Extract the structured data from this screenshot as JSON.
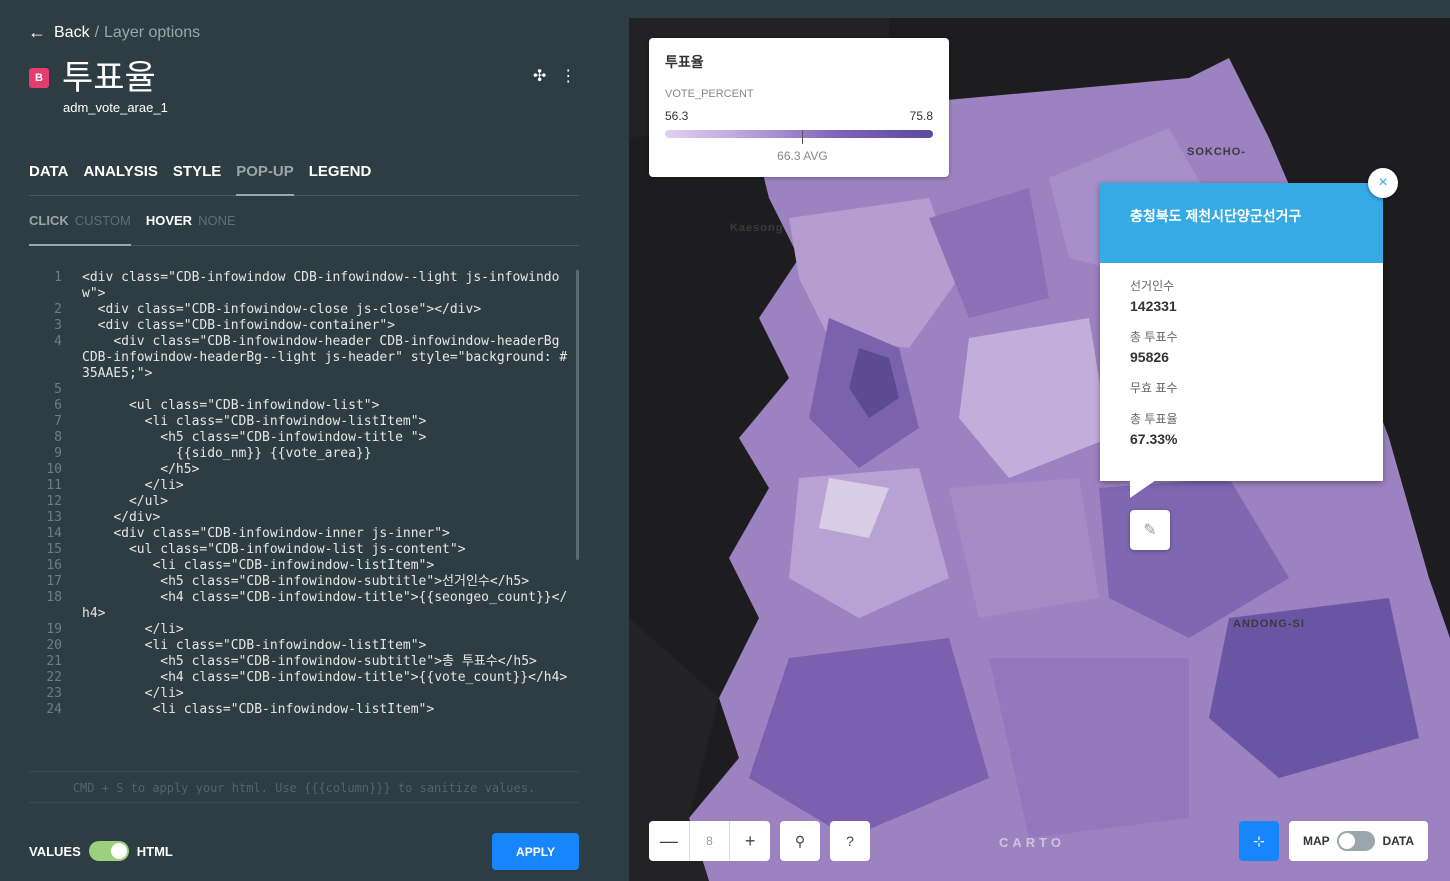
{
  "header": {
    "back_label": "Back",
    "separator": "/",
    "section": "Layer options",
    "layer_letter": "B",
    "layer_title": "투표율",
    "layer_source": "adm_vote_arae_1"
  },
  "tabs": [
    "DATA",
    "ANALYSIS",
    "STYLE",
    "POP-UP",
    "LEGEND"
  ],
  "subtabs": {
    "click": "CLICK",
    "custom": "CUSTOM",
    "hover": "HOVER",
    "none": "NONE"
  },
  "editor": {
    "lines": [
      {
        "n": "1",
        "code": "<div class=\"CDB-infowindow CDB-infowindow--light js-infowindow\">"
      },
      {
        "n": "2",
        "code": "  <div class=\"CDB-infowindow-close js-close\"></div>"
      },
      {
        "n": "3",
        "code": "  <div class=\"CDB-infowindow-container\">"
      },
      {
        "n": "4",
        "code": "    <div class=\"CDB-infowindow-header CDB-infowindow-headerBg CDB-infowindow-headerBg--light js-header\" style=\"background: #35AAE5;\">"
      },
      {
        "n": "5",
        "code": ""
      },
      {
        "n": "6",
        "code": "      <ul class=\"CDB-infowindow-list\">"
      },
      {
        "n": "7",
        "code": "        <li class=\"CDB-infowindow-listItem\">"
      },
      {
        "n": "8",
        "code": "          <h5 class=\"CDB-infowindow-title \">"
      },
      {
        "n": "9",
        "code": "            {{sido_nm}} {{vote_area}}"
      },
      {
        "n": "10",
        "code": "          </h5>"
      },
      {
        "n": "11",
        "code": "        </li>"
      },
      {
        "n": "12",
        "code": "      </ul>"
      },
      {
        "n": "13",
        "code": "    </div>"
      },
      {
        "n": "14",
        "code": "    <div class=\"CDB-infowindow-inner js-inner\">"
      },
      {
        "n": "15",
        "code": "      <ul class=\"CDB-infowindow-list js-content\">"
      },
      {
        "n": "16",
        "code": "         <li class=\"CDB-infowindow-listItem\">"
      },
      {
        "n": "17",
        "code": "          <h5 class=\"CDB-infowindow-subtitle\">선거인수</h5>"
      },
      {
        "n": "18",
        "code": "          <h4 class=\"CDB-infowindow-title\">{{seongeo_count}}</h4>"
      },
      {
        "n": "19",
        "code": "        </li>"
      },
      {
        "n": "20",
        "code": "        <li class=\"CDB-infowindow-listItem\">"
      },
      {
        "n": "21",
        "code": "          <h5 class=\"CDB-infowindow-subtitle\">총 투표수</h5>"
      },
      {
        "n": "22",
        "code": "          <h4 class=\"CDB-infowindow-title\">{{vote_count}}</h4>"
      },
      {
        "n": "23",
        "code": "        </li>"
      },
      {
        "n": "24",
        "code": "         <li class=\"CDB-infowindow-listItem\">"
      }
    ]
  },
  "hint": "CMD + S to apply your html. Use {{{column}}} to sanitize values.",
  "footer": {
    "values_label": "VALUES",
    "html_label": "HTML",
    "apply_label": "APPLY"
  },
  "legend": {
    "title": "투표율",
    "field": "VOTE_PERCENT",
    "min": "56.3",
    "max": "75.8",
    "avg_label": "66.3 AVG",
    "avg_value": 66.3,
    "min_value": 56.3,
    "max_value": 75.8
  },
  "popup": {
    "title": "충청북도 제천시단양군선거구",
    "items": [
      {
        "label": "선거인수",
        "value": "142331"
      },
      {
        "label": "총 투표수",
        "value": "95826"
      },
      {
        "label": "무효 표수",
        "value": ""
      },
      {
        "label": "총 투표율",
        "value": "67.33%"
      }
    ],
    "close": "×"
  },
  "map": {
    "zoom_level": "8",
    "zoom_out": "—",
    "zoom_in": "+",
    "help": "?",
    "brand": "CARTO",
    "map_label": "MAP",
    "data_label": "DATA",
    "place_labels": [
      "SOKCHO-",
      "Kaesong",
      "ANDONG-SI"
    ]
  },
  "colors": {
    "panel_bg": "#2e3c43",
    "accent_blue": "#1785fb",
    "popup_header": "#35aae5",
    "badge": "#e53e6d",
    "toggle_on": "#9bd17d"
  }
}
